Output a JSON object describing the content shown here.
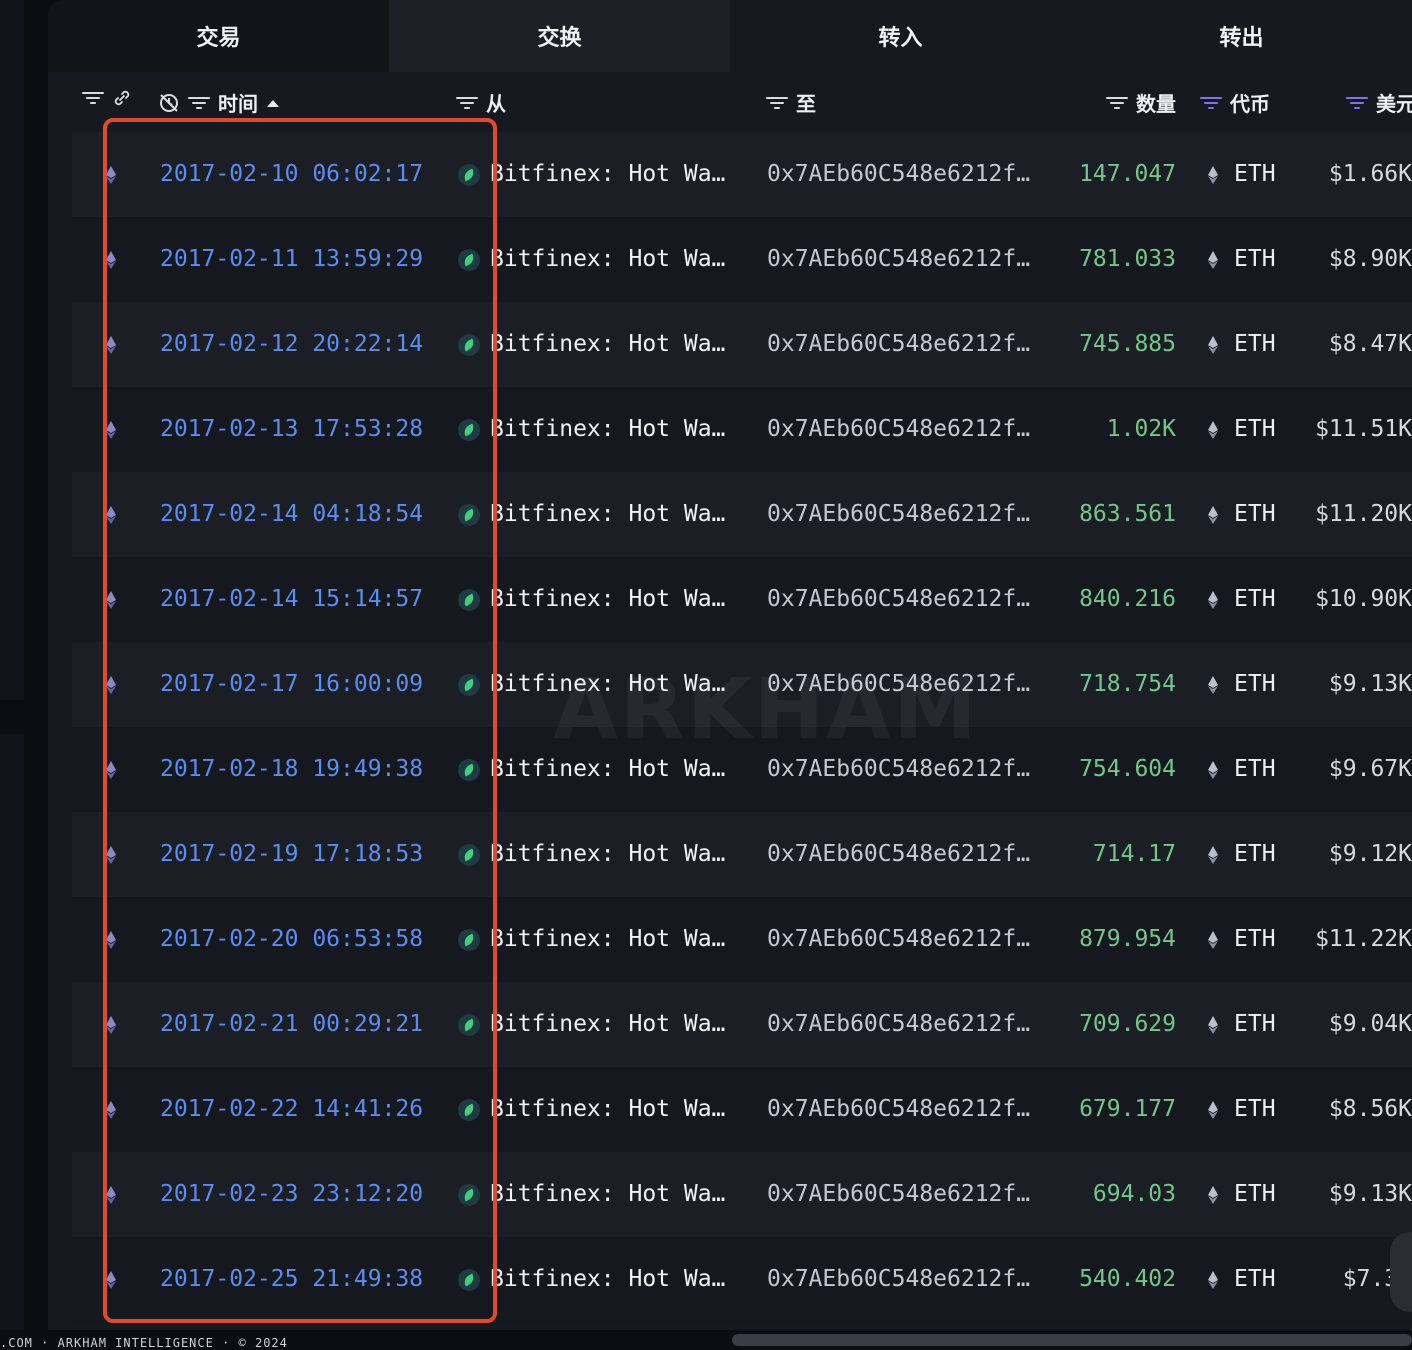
{
  "tabs": [
    "交易",
    "交换",
    "转入",
    "转出"
  ],
  "columns": {
    "time": "时间",
    "from": "从",
    "to": "至",
    "quantity": "数量",
    "token": "代币",
    "usd": "美元"
  },
  "icons": {
    "filter": "filter-icon",
    "link": "link-icon",
    "clock_off": "clock-off-icon",
    "sort_up": "sort-up-icon",
    "eth": "eth-icon",
    "exchange": "exchange-icon"
  },
  "colors": {
    "time_link": "#5b8df0",
    "quantity": "#73c78a",
    "highlight": "#e34a2c",
    "token_filter": "#8a6cf0"
  },
  "rows": [
    {
      "time": "2017-02-10 06:02:17",
      "from": "Bitfinex: Hot Wa…",
      "to": "0x7AEb60C548e6212f…",
      "qty": "147.047",
      "token": "ETH",
      "usd": "$1.66K"
    },
    {
      "time": "2017-02-11 13:59:29",
      "from": "Bitfinex: Hot Wa…",
      "to": "0x7AEb60C548e6212f…",
      "qty": "781.033",
      "token": "ETH",
      "usd": "$8.90K"
    },
    {
      "time": "2017-02-12 20:22:14",
      "from": "Bitfinex: Hot Wa…",
      "to": "0x7AEb60C548e6212f…",
      "qty": "745.885",
      "token": "ETH",
      "usd": "$8.47K"
    },
    {
      "time": "2017-02-13 17:53:28",
      "from": "Bitfinex: Hot Wa…",
      "to": "0x7AEb60C548e6212f…",
      "qty": "1.02K",
      "token": "ETH",
      "usd": "$11.51K"
    },
    {
      "time": "2017-02-14 04:18:54",
      "from": "Bitfinex: Hot Wa…",
      "to": "0x7AEb60C548e6212f…",
      "qty": "863.561",
      "token": "ETH",
      "usd": "$11.20K"
    },
    {
      "time": "2017-02-14 15:14:57",
      "from": "Bitfinex: Hot Wa…",
      "to": "0x7AEb60C548e6212f…",
      "qty": "840.216",
      "token": "ETH",
      "usd": "$10.90K"
    },
    {
      "time": "2017-02-17 16:00:09",
      "from": "Bitfinex: Hot Wa…",
      "to": "0x7AEb60C548e6212f…",
      "qty": "718.754",
      "token": "ETH",
      "usd": "$9.13K"
    },
    {
      "time": "2017-02-18 19:49:38",
      "from": "Bitfinex: Hot Wa…",
      "to": "0x7AEb60C548e6212f…",
      "qty": "754.604",
      "token": "ETH",
      "usd": "$9.67K"
    },
    {
      "time": "2017-02-19 17:18:53",
      "from": "Bitfinex: Hot Wa…",
      "to": "0x7AEb60C548e6212f…",
      "qty": "714.17",
      "token": "ETH",
      "usd": "$9.12K"
    },
    {
      "time": "2017-02-20 06:53:58",
      "from": "Bitfinex: Hot Wa…",
      "to": "0x7AEb60C548e6212f…",
      "qty": "879.954",
      "token": "ETH",
      "usd": "$11.22K"
    },
    {
      "time": "2017-02-21 00:29:21",
      "from": "Bitfinex: Hot Wa…",
      "to": "0x7AEb60C548e6212f…",
      "qty": "709.629",
      "token": "ETH",
      "usd": "$9.04K"
    },
    {
      "time": "2017-02-22 14:41:26",
      "from": "Bitfinex: Hot Wa…",
      "to": "0x7AEb60C548e6212f…",
      "qty": "679.177",
      "token": "ETH",
      "usd": "$8.56K"
    },
    {
      "time": "2017-02-23 23:12:20",
      "from": "Bitfinex: Hot Wa…",
      "to": "0x7AEb60C548e6212f…",
      "qty": "694.03",
      "token": "ETH",
      "usd": "$9.13K"
    },
    {
      "time": "2017-02-25 21:49:38",
      "from": "Bitfinex: Hot Wa…",
      "to": "0x7AEb60C548e6212f…",
      "qty": "540.402",
      "token": "ETH",
      "usd": "$7.3…"
    }
  ],
  "watermark": "ARKHAM",
  "footer": ".COM · ARKHAM INTELLIGENCE · © 2024"
}
